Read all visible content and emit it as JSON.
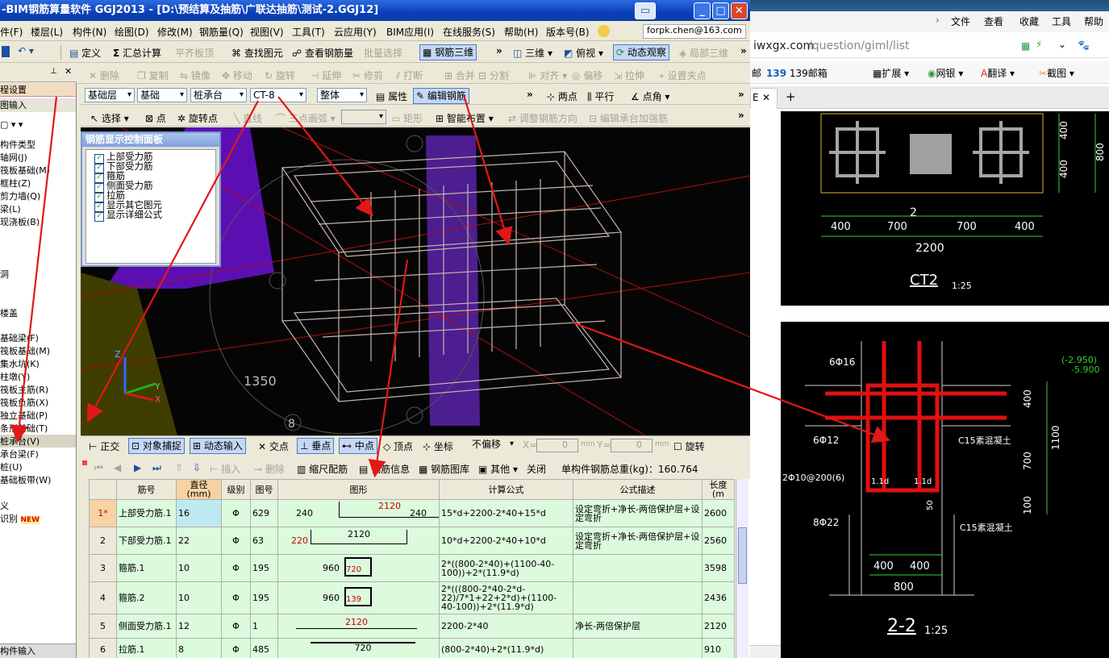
{
  "app": {
    "title": "-BIM钢筋算量软件 GGJ2013 - [D:\\预结算及抽筋\\广联达抽筋\\测试-2.GGJ12]",
    "min": "_",
    "max": "□",
    "close": "✕"
  },
  "menu": [
    "件(F)",
    "楼层(L)",
    "构件(N)",
    "绘图(D)",
    "修改(M)",
    "钢筋量(Q)",
    "视图(V)",
    "工具(T)",
    "云应用(Y)",
    "BIM应用(I)",
    "在线服务(S)",
    "帮助(H)",
    "版本号(B)"
  ],
  "user_email": "forpk.chen@163.com",
  "toolbar1": {
    "define": "定义",
    "sum": "汇总计算",
    "level": "平齐板顶",
    "find": "查找图元",
    "view_rebar": "查看钢筋量",
    "batch": "批量选择",
    "rebar3d": "钢筋三维",
    "threed": "三维",
    "top": "俯视",
    "dynamic": "动态观察",
    "local3d": "局部三维"
  },
  "toolbar2": {
    "delete": "删除",
    "copy": "复制",
    "mirror": "镜像",
    "move": "移动",
    "rotate": "旋转",
    "extend": "延伸",
    "trim": "修剪",
    "break": "打断",
    "merge": "合并",
    "split": "分割",
    "align": "对齐",
    "offset": "偏移",
    "stretch": "拉伸",
    "set_point": "设置夹点"
  },
  "toolbar3": {
    "layer": "基础层",
    "type": "基础",
    "comp": "桩承台",
    "name": "CT-8",
    "whole": "整体",
    "attr": "属性",
    "edit": "编辑钢筋",
    "two": "两点",
    "parallel": "平行",
    "angle": "点角"
  },
  "toolbar4": {
    "select": "选择",
    "point": "点",
    "rotpoint": "旋转点",
    "line": "直线",
    "arc": "三点画弧",
    "rect": "矩形",
    "smart": "智能布置",
    "adjust": "调整钢筋方向",
    "edit_cap": "编辑承台加强筋"
  },
  "left": {
    "title": "程设置",
    "input": "图输入",
    "items": [
      "构件类型",
      "轴网(J)",
      "筏板基础(M)",
      "框柱(Z)",
      "剪力墙(Q)",
      "梁(L)",
      "现浇板(B)",
      "洞",
      "楼盖",
      "基础梁(F)",
      "筏板基础(M)",
      "集水坑(K)",
      "柱墩(Y)",
      "筏板主筋(R)",
      "筏板负筋(X)",
      "独立基础(P)",
      "条形基础(T)",
      "桩承台(V)",
      "承台梁(F)",
      "桩(U)",
      "基础板带(W)",
      "义",
      "识别"
    ],
    "new": "NEW",
    "footer": "构件输入"
  },
  "ctrl": {
    "title": "钢筋显示控制面板",
    "items": [
      "上部受力筋",
      "下部受力筋",
      "箍筋",
      "侧面受力筋",
      "拉筋",
      "显示其它图元",
      "显示详细公式"
    ]
  },
  "viewport": {
    "dim": "1350",
    "axis_num": "8",
    "z": "Z",
    "y": "Y",
    "x": "X"
  },
  "snap": {
    "ortho": "正交",
    "obj_snap": "对象捕捉",
    "dyn_input": "动态输入",
    "intersect": "交点",
    "perp": "垂点",
    "mid": "中点",
    "vertex": "顶点",
    "coord": "坐标",
    "no_offset": "不偏移",
    "x": "X=",
    "y": "Y=",
    "xv": "0",
    "yv": "0",
    "mm": "mm",
    "rotate": "旋转"
  },
  "gridtb": {
    "insert": "插入",
    "delete": "删除",
    "scale": "缩尺配筋",
    "info": "钢筋信息",
    "lib": "钢筋图库",
    "other": "其他",
    "close": "关闭",
    "total": "单构件钢筋总重(kg)：160.764"
  },
  "cols": [
    "筋号",
    "直径(mm)",
    "级别",
    "图号",
    "图形",
    "计算公式",
    "公式描述",
    "长度(m"
  ],
  "rows": [
    {
      "no": "1*",
      "name": "上部受力筋.1",
      "d": "16",
      "grade": "Φ",
      "fig": "629",
      "sl": "240",
      "sm": "2120",
      "sr": "240",
      "formula": "15*d+2200-2*40+15*d",
      "desc": "设定弯折+净长-两倍保护层+设定弯折",
      "len": "2600"
    },
    {
      "no": "2",
      "name": "下部受力筋.1",
      "d": "22",
      "grade": "Φ",
      "fig": "63",
      "sl": "220",
      "sm": "2120",
      "sr": "",
      "formula": "10*d+2200-2*40+10*d",
      "desc": "设定弯折+净长-两倍保护层+设定弯折",
      "len": "2560"
    },
    {
      "no": "3",
      "name": "箍筋.1",
      "d": "10",
      "grade": "Φ",
      "fig": "195",
      "sl": "960",
      "sm": "720",
      "sr": "",
      "formula": "2*((800-2*40)+(1100-40-100))+2*(11.9*d)",
      "desc": "",
      "len": "3598"
    },
    {
      "no": "4",
      "name": "箍筋.2",
      "d": "10",
      "grade": "Φ",
      "fig": "195",
      "sl": "960",
      "sm": "139",
      "sr": "",
      "formula": "2*(((800-2*40-2*d-22)/7*1+22+2*d)+(1100-40-100))+2*(11.9*d)",
      "desc": "",
      "len": "2436"
    },
    {
      "no": "5",
      "name": "侧面受力筋.1",
      "d": "12",
      "grade": "Φ",
      "fig": "1",
      "sl": "",
      "sm": "2120",
      "sr": "",
      "formula": "2200-2*40",
      "desc": "净长-两倍保护层",
      "len": "2120"
    },
    {
      "no": "6",
      "name": "拉筋.1",
      "d": "8",
      "grade": "Φ",
      "fig": "485",
      "sl": "",
      "sm": "720",
      "sr": "",
      "formula": "(800-2*40)+2*(11.9*d)",
      "desc": "",
      "len": "910"
    }
  ],
  "browser": {
    "menu": [
      "文件",
      "查看",
      "收藏",
      "工具",
      "帮助"
    ],
    "url": "iwxgx.com/question/giml/list",
    "url_host": "iwxgx.com",
    "url_path": "/question/giml/list",
    "fav": [
      "139邮箱",
      "扩展",
      "网银",
      "翻译",
      "截图"
    ],
    "tab": "E",
    "new_tab": "+"
  },
  "cad1": {
    "dims": [
      "400",
      "400",
      "800",
      "400",
      "700",
      "700",
      "400",
      "2200",
      "2"
    ],
    "label": "CT2",
    "scale": "1:25"
  },
  "cad2": {
    "labels": [
      "6Φ16",
      "6Φ12",
      "2Φ10@200(6)",
      "8Φ22",
      "C15素混凝土",
      "C15素混凝土",
      "(-2.950)",
      "-5.900",
      "400",
      "1100",
      "700",
      "100",
      "400",
      "400",
      "800",
      "1.1d",
      "1.1d",
      "50"
    ],
    "title": "2-2",
    "scale": "1:25"
  }
}
